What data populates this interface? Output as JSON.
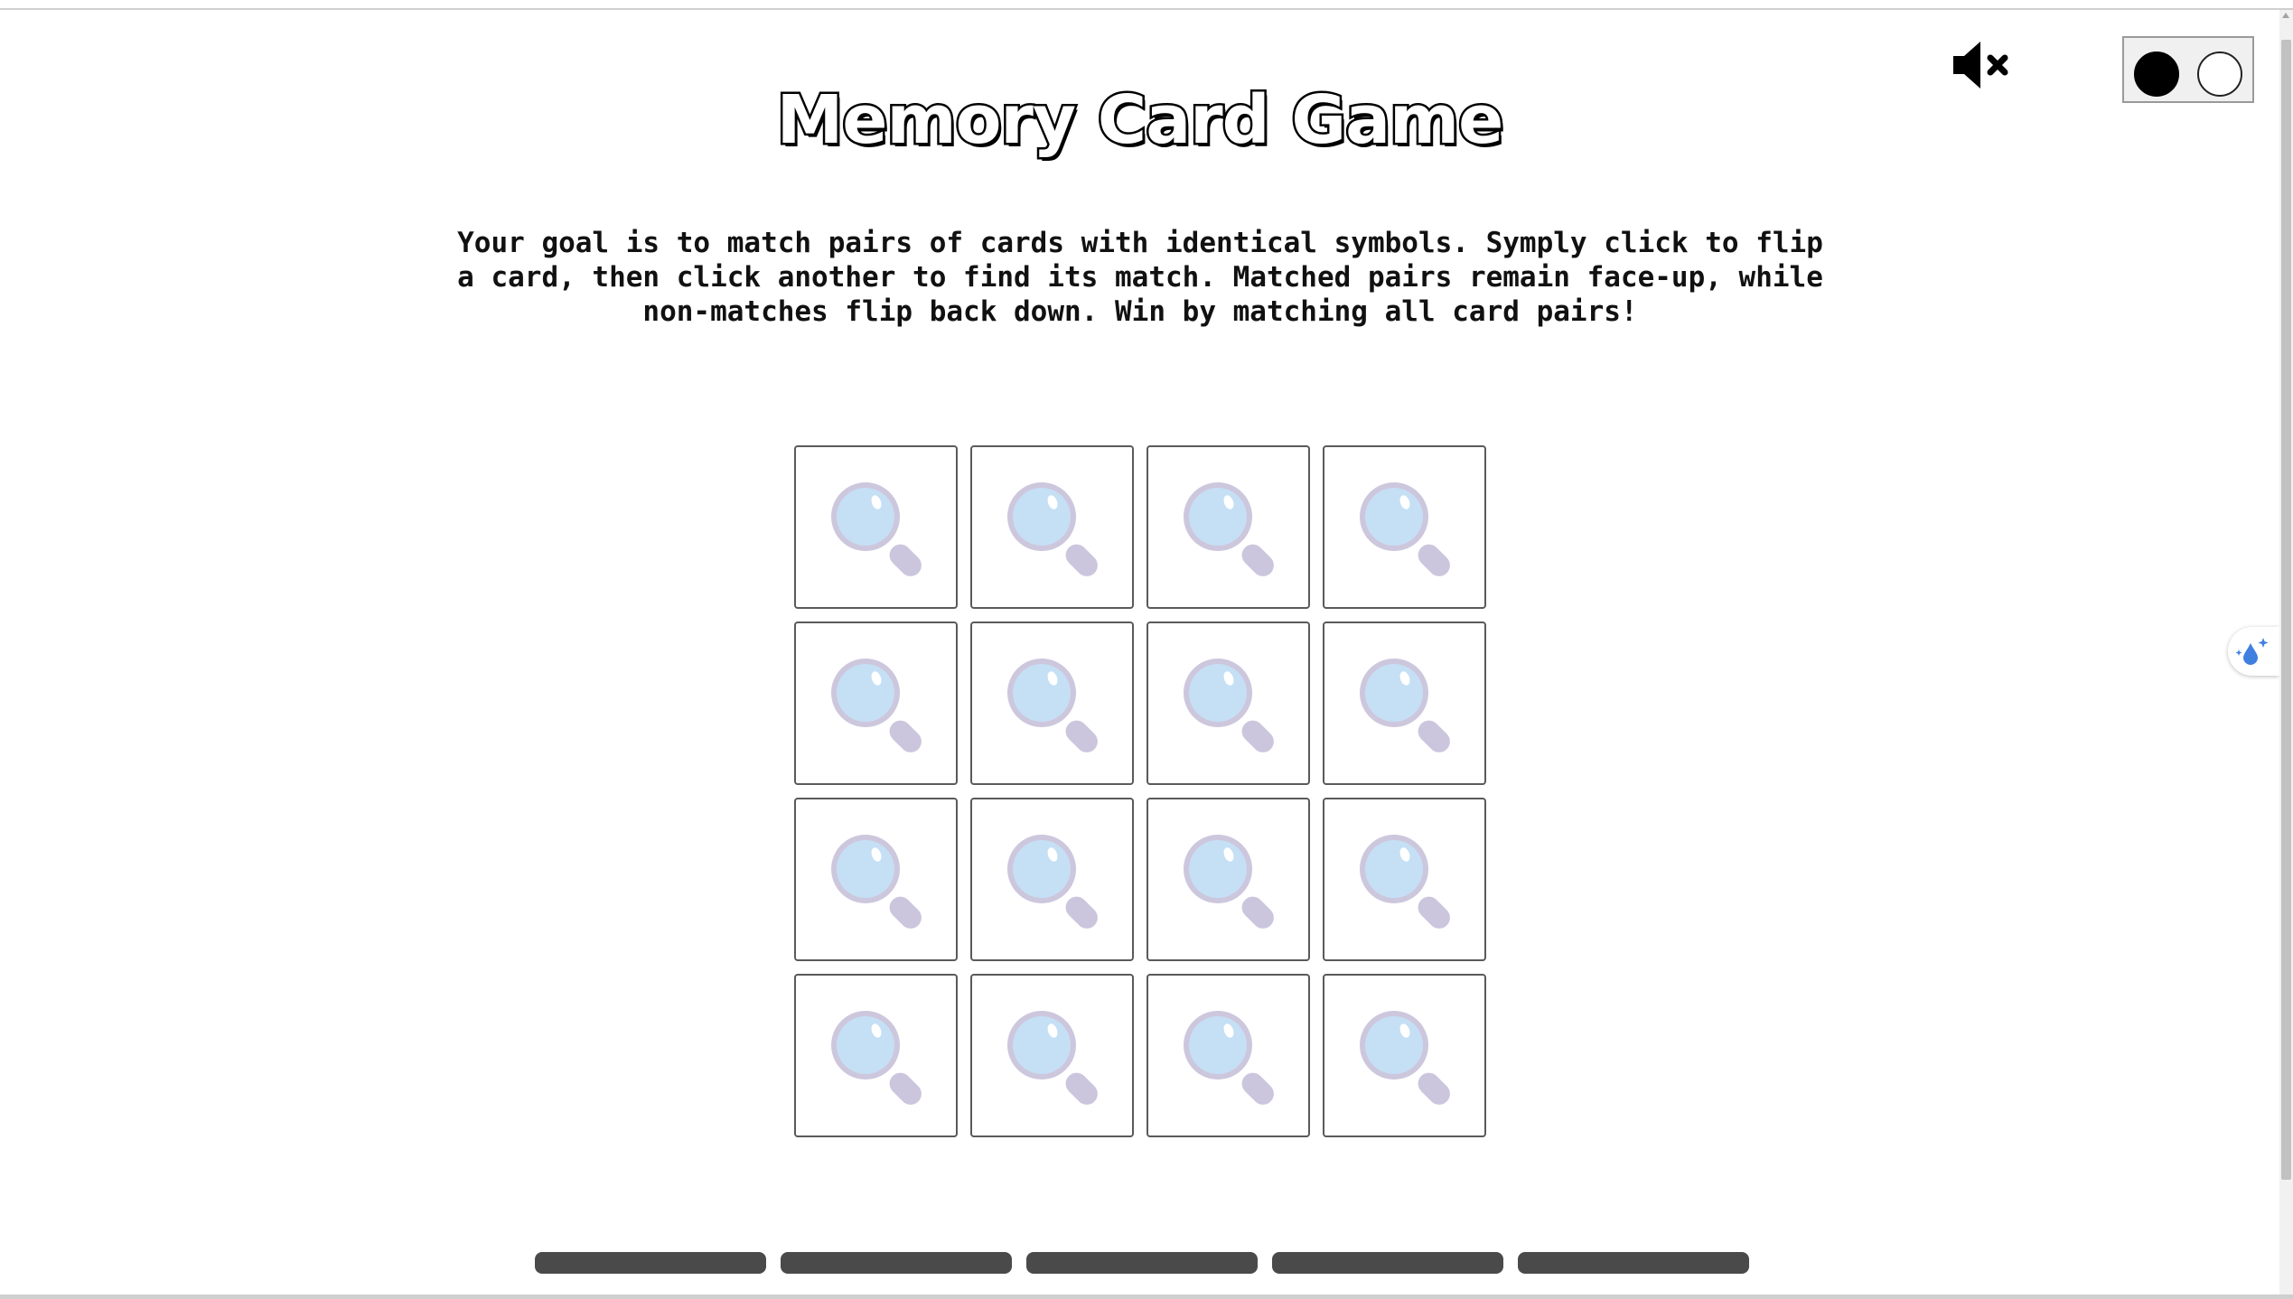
{
  "title": "Memory Card Game",
  "instructions": "Your goal is to match pairs of cards with identical symbols. Symply click to flip a card, then click another to find its match. Matched pairs remain face-up, while non-matches flip back down. Win by matching all card pairs!",
  "header": {
    "mute_icon": "speaker-muted-icon",
    "theme_toggle": {
      "options": [
        "dark",
        "light"
      ]
    }
  },
  "board": {
    "rows": 4,
    "columns": 4,
    "card_back_icon": "magnifying-glass-icon",
    "cards": [
      {
        "state": "face-down"
      },
      {
        "state": "face-down"
      },
      {
        "state": "face-down"
      },
      {
        "state": "face-down"
      },
      {
        "state": "face-down"
      },
      {
        "state": "face-down"
      },
      {
        "state": "face-down"
      },
      {
        "state": "face-down"
      },
      {
        "state": "face-down"
      },
      {
        "state": "face-down"
      },
      {
        "state": "face-down"
      },
      {
        "state": "face-down"
      },
      {
        "state": "face-down"
      },
      {
        "state": "face-down"
      },
      {
        "state": "face-down"
      },
      {
        "state": "face-down"
      }
    ]
  },
  "footer": {
    "progress_bar_count": 5
  },
  "colors": {
    "card_border": "#5a5a5a",
    "lens_fill": "#c5dff5",
    "lens_rim": "#cdc7dd",
    "handle": "#cbc6dd",
    "highlight": "#ffffff",
    "bar": "#4a4a4a",
    "side_widget_icon": "#3f7fe0"
  },
  "side_widget_icon": "sparkle-droplet-icon"
}
